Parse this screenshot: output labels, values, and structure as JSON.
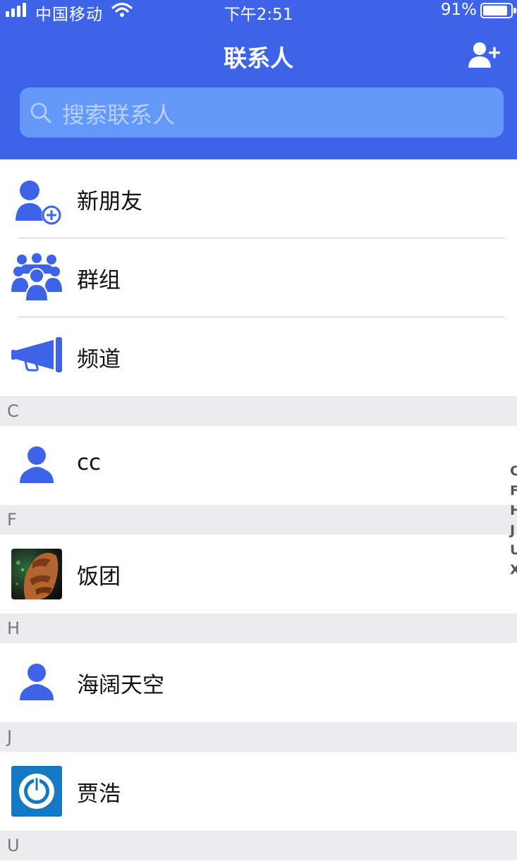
{
  "status_bar": {
    "carrier": "中国移动",
    "time": "下午2:51",
    "battery_percent": "91%",
    "battery_level": 0.91
  },
  "nav": {
    "title": "联系人",
    "add_icon": "add-contact-icon"
  },
  "search": {
    "placeholder": "搜索联系人",
    "icon": "search-icon"
  },
  "menu": [
    {
      "label": "新朋友",
      "icon": "new-friend-icon"
    },
    {
      "label": "群组",
      "icon": "group-icon"
    },
    {
      "label": "频道",
      "icon": "megaphone-icon"
    }
  ],
  "sections": [
    {
      "letter": "C",
      "contacts": [
        {
          "name": "cc",
          "avatar": "default-person-avatar"
        }
      ]
    },
    {
      "letter": "F",
      "contacts": [
        {
          "name": "饭团",
          "avatar": "photo-avatar"
        }
      ]
    },
    {
      "letter": "H",
      "contacts": [
        {
          "name": "海阔天空",
          "avatar": "default-person-avatar"
        }
      ]
    },
    {
      "letter": "J",
      "contacts": [
        {
          "name": "贾浩",
          "avatar": "power-logo-avatar"
        }
      ]
    },
    {
      "letter": "U",
      "contacts": []
    }
  ],
  "index_letters": [
    "C",
    "F",
    "H",
    "J",
    "U",
    "X"
  ],
  "colors": {
    "primary": "#3c63e8",
    "search_bg": "#6599f9",
    "section_bg": "#ececee",
    "icon_blue": "#3c63e8"
  }
}
